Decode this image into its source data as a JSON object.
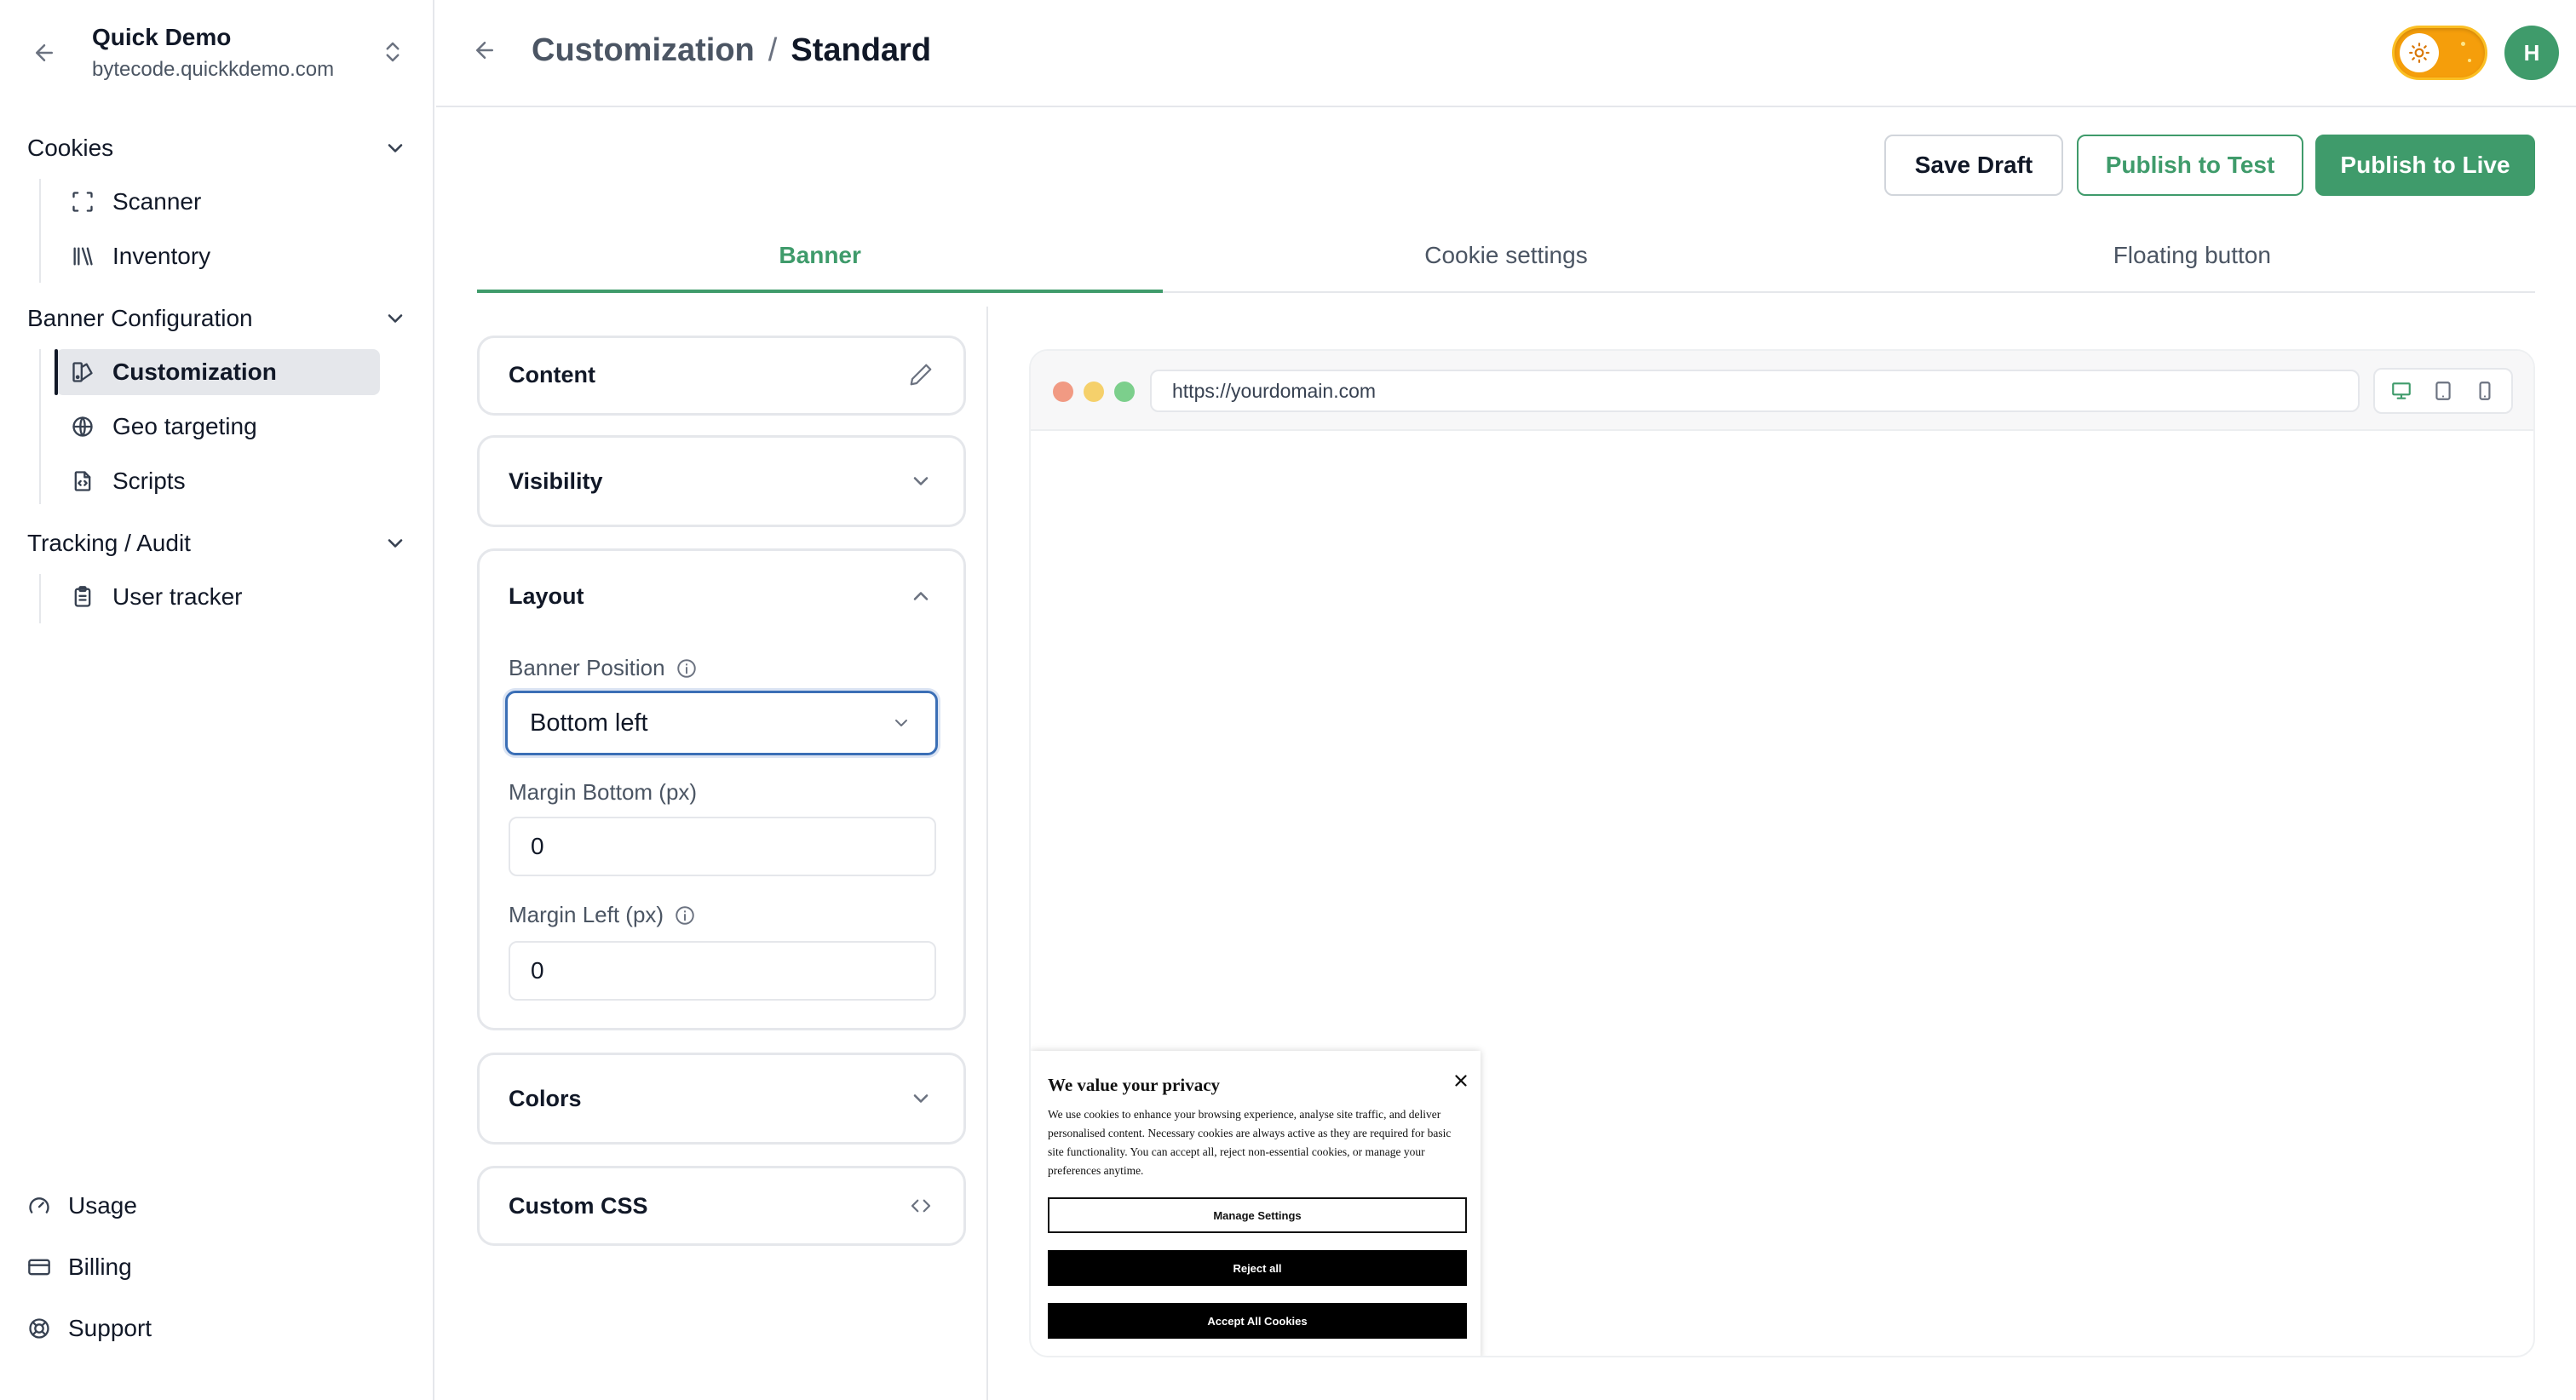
{
  "workspace": {
    "name": "Quick Demo",
    "domain": "bytecode.quickkdemo.com"
  },
  "sidebar": {
    "groups": [
      {
        "label": "Cookies",
        "items": [
          {
            "label": "Scanner",
            "icon": "scan-icon"
          },
          {
            "label": "Inventory",
            "icon": "library-icon"
          }
        ]
      },
      {
        "label": "Banner Configuration",
        "items": [
          {
            "label": "Customization",
            "icon": "palette-icon",
            "active": true
          },
          {
            "label": "Geo targeting",
            "icon": "globe-icon"
          },
          {
            "label": "Scripts",
            "icon": "file-code-icon"
          }
        ]
      },
      {
        "label": "Tracking / Audit",
        "items": [
          {
            "label": "User tracker",
            "icon": "clipboard-icon"
          }
        ]
      }
    ],
    "bottom": [
      {
        "label": "Usage",
        "icon": "gauge-icon"
      },
      {
        "label": "Billing",
        "icon": "credit-card-icon"
      },
      {
        "label": "Support",
        "icon": "life-buoy-icon"
      }
    ]
  },
  "header": {
    "crumb_parent": "Customization",
    "crumb_sep": "/",
    "crumb_current": "Standard",
    "avatar_initial": "H"
  },
  "actions": {
    "save_draft": "Save Draft",
    "publish_test": "Publish to Test",
    "publish_live": "Publish to Live"
  },
  "tabs": [
    {
      "label": "Banner",
      "active": true
    },
    {
      "label": "Cookie settings"
    },
    {
      "label": "Floating button"
    }
  ],
  "panels": {
    "content": "Content",
    "visibility": "Visibility",
    "layout": "Layout",
    "colors": "Colors",
    "custom_css": "Custom CSS"
  },
  "layout_form": {
    "banner_position_label": "Banner Position",
    "banner_position_value": "Bottom left",
    "margin_bottom_label": "Margin Bottom (px)",
    "margin_bottom_value": "0",
    "margin_left_label": "Margin Left (px)",
    "margin_left_value": "0"
  },
  "preview": {
    "url": "https://yourdomain.com",
    "banner": {
      "title": "We value your privacy",
      "text": "We use cookies to enhance your browsing experience, analyse site traffic, and deliver personalised content. Necessary cookies are always active as they are required for basic site functionality. You can accept all, reject non-essential cookies, or manage your preferences anytime.",
      "manage": "Manage Settings",
      "reject": "Reject all",
      "accept": "Accept All Cookies"
    }
  },
  "colors": {
    "accent": "#3f9b6b",
    "focus": "#3b6fb6",
    "toggle": "#f59e0b"
  }
}
